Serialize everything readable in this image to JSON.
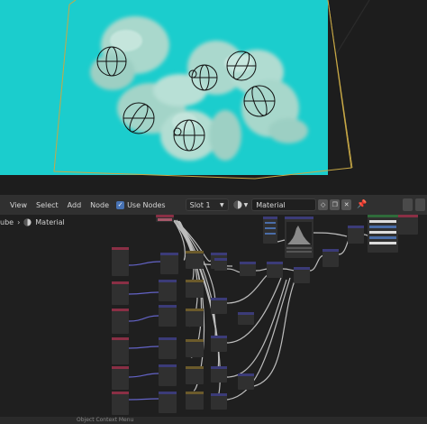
{
  "node_editor_header": {
    "menu": [
      "View",
      "Select",
      "Add",
      "Node"
    ],
    "use_nodes_label": "Use Nodes",
    "use_nodes_checked": true,
    "slot_value": "Slot 1",
    "material_name": "Material"
  },
  "breadcrumb": {
    "object": "ube",
    "material": "Material"
  },
  "status_bar": {
    "context_menu_label": "Object Context Menu"
  },
  "colors": {
    "viewport_background": "#1bcdcd",
    "smoke": "#a9d8cc",
    "bounding_box": "#c8a845",
    "node_editor_bg": "#1f1f1f",
    "node_body": "#303030",
    "node_header_input": "#8a2f45",
    "node_header_texture": "#3b3b78",
    "node_header_shader": "#2f6b3a",
    "noodle": "#bdbdbd",
    "noodle_vector": "#6363c7"
  }
}
